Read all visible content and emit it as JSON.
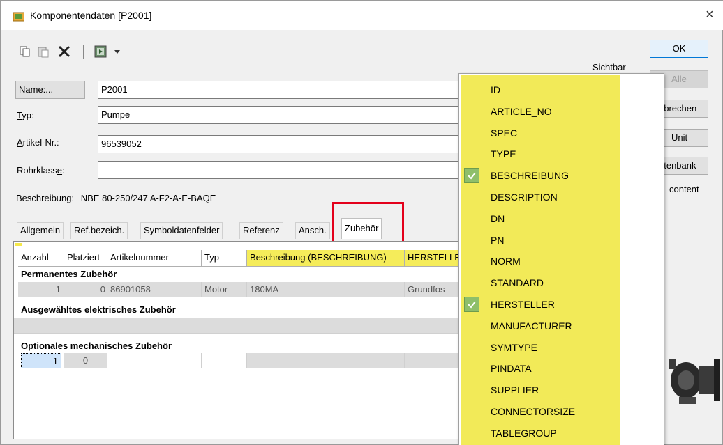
{
  "window": {
    "title": "Komponentendaten [P2001]",
    "close_glyph": "×"
  },
  "toolbar": {
    "icons": [
      "copy-icon",
      "paste-icon",
      "delete-icon",
      "database-icon",
      "dropdown-arrow-icon"
    ]
  },
  "side": {
    "sichtbar": "Sichtbar",
    "ok": "OK",
    "alle": "Alle",
    "abbrechen": "bbrechen",
    "unit": "Unit",
    "datenbank": "atenbank",
    "content": "content"
  },
  "fields": {
    "name_button": "Name:...",
    "name_value": "P2001",
    "typ_label_u": "T",
    "typ_label_rest": "yp:",
    "typ_value": "Pumpe",
    "artikel_label_u": "A",
    "artikel_label_rest": "rtikel-Nr.:",
    "artikel_value": "96539052",
    "rohr_label_start": "Rohrklass",
    "rohr_label_u": "e",
    "rohr_label_end": ":",
    "rohr_value": ""
  },
  "beschreibung": {
    "label": "Beschreibung:",
    "value": "NBE 80-250/247 A-F2-A-E-BAQE"
  },
  "tabs": [
    "Allgemein",
    "Ref.bezeich.",
    "Symboldatenfelder",
    "Referenz",
    "Ansch.",
    "Zubehör"
  ],
  "grid": {
    "headers": [
      "Anzahl",
      "Platziert",
      "Artikelnummer",
      "Typ",
      "Beschreibung (BESCHREIBUNG)",
      "HERSTELLER"
    ],
    "sections": [
      {
        "title": "Permanentes Zubehör",
        "rows": [
          {
            "anzahl": "1",
            "platziert": "0",
            "artikel": "86901058",
            "typ": "Motor",
            "beschreibung": "180MA",
            "hersteller": "Grundfos"
          }
        ]
      },
      {
        "title": "Ausgewähltes elektrisches Zubehör",
        "rows": []
      },
      {
        "title": "Optionales mechanisches Zubehör",
        "rows": [
          {
            "anzahl": "1",
            "platziert": "0",
            "artikel": "",
            "typ": "",
            "beschreibung": "",
            "hersteller": ""
          }
        ]
      }
    ]
  },
  "popup": {
    "items": [
      {
        "label": "ID",
        "checked": false
      },
      {
        "label": "ARTICLE_NO",
        "checked": false
      },
      {
        "label": "SPEC",
        "checked": false
      },
      {
        "label": "TYPE",
        "checked": false
      },
      {
        "label": "BESCHREIBUNG",
        "checked": true
      },
      {
        "label": "DESCRIPTION",
        "checked": false
      },
      {
        "label": "DN",
        "checked": false
      },
      {
        "label": "PN",
        "checked": false
      },
      {
        "label": "NORM",
        "checked": false
      },
      {
        "label": "STANDARD",
        "checked": false
      },
      {
        "label": "HERSTELLER",
        "checked": true
      },
      {
        "label": "MANUFACTURER",
        "checked": false
      },
      {
        "label": "SYMTYPE",
        "checked": false
      },
      {
        "label": "PINDATA",
        "checked": false
      },
      {
        "label": "SUPPLIER",
        "checked": false
      },
      {
        "label": "CONNECTORSIZE",
        "checked": false
      },
      {
        "label": "TABLEGROUP",
        "checked": false
      }
    ]
  },
  "colors": {
    "highlight_yellow": "#f2ea58",
    "check_green": "#8fbf6a",
    "annotation_red": "#e3001b"
  }
}
